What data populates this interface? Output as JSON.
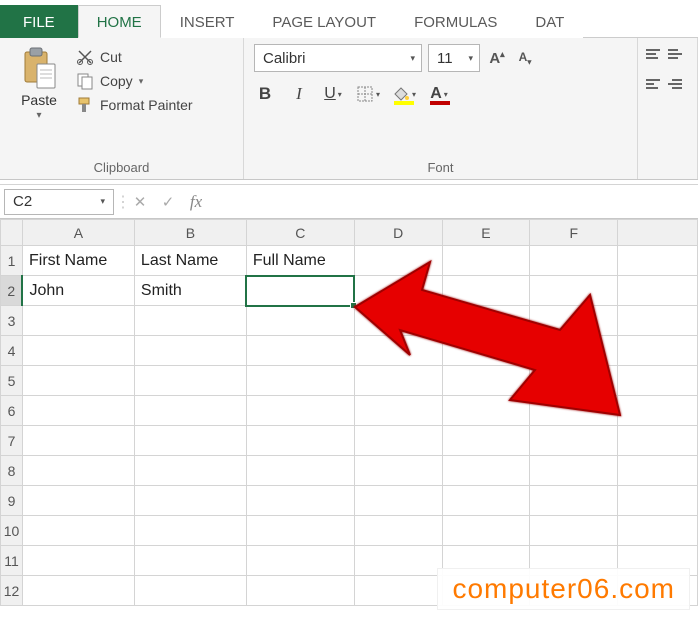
{
  "tabs": {
    "file": "FILE",
    "home": "HOME",
    "insert": "INSERT",
    "page_layout": "PAGE LAYOUT",
    "formulas": "FORMULAS",
    "data": "DAT"
  },
  "ribbon": {
    "clipboard": {
      "paste": "Paste",
      "cut": "Cut",
      "copy": "Copy",
      "format_painter": "Format Painter",
      "group_label": "Clipboard"
    },
    "font": {
      "name": "Calibri",
      "size": "11",
      "group_label": "Font",
      "fill_color": "#ffff00",
      "font_color": "#c00000"
    }
  },
  "formula_bar": {
    "name_box": "C2",
    "formula": ""
  },
  "sheet": {
    "columns": [
      "A",
      "B",
      "C",
      "D",
      "E",
      "F"
    ],
    "active_row": 2,
    "cells": {
      "A1": "First Name",
      "B1": "Last Name",
      "C1": "Full Name",
      "A2": "John",
      "B2": "Smith"
    },
    "selected": "C2",
    "visible_rows": 12
  },
  "watermark": "computer06.com"
}
